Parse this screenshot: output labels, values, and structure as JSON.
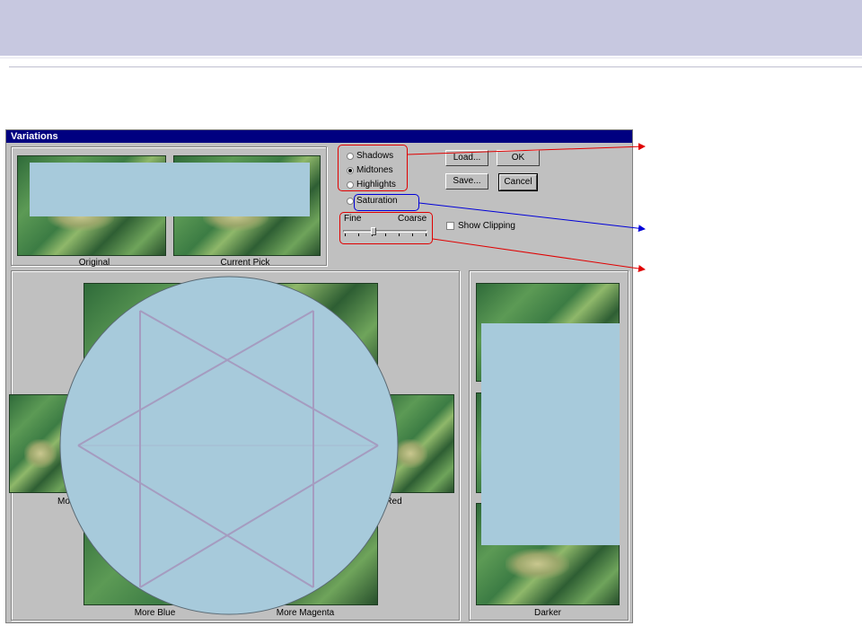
{
  "dialog": {
    "title": "Variations",
    "thumbnails": {
      "original": "Original",
      "current_pick": "Current Pick",
      "more_blue": "More Blue",
      "more_magenta": "More Magenta",
      "more_partial_left": "Mo",
      "more_red_partial": "e Red",
      "darker": "Darker"
    },
    "tone_options": [
      {
        "label": "Shadows",
        "selected": false
      },
      {
        "label": "Midtones",
        "selected": true
      },
      {
        "label": "Highlights",
        "selected": false
      },
      {
        "label": "Saturation",
        "selected": false
      }
    ],
    "slider": {
      "fine_label": "Fine",
      "coarse_label": "Coarse"
    },
    "show_clipping": {
      "label": "Show Clipping",
      "checked": false
    },
    "buttons": {
      "load": "Load...",
      "ok": "OK",
      "save": "Save...",
      "cancel": "Cancel"
    }
  },
  "colors": {
    "annotation_red": "#e00000",
    "annotation_blue": "#0000d8",
    "redaction": "#a7cadb",
    "star": "#a59cc0"
  }
}
